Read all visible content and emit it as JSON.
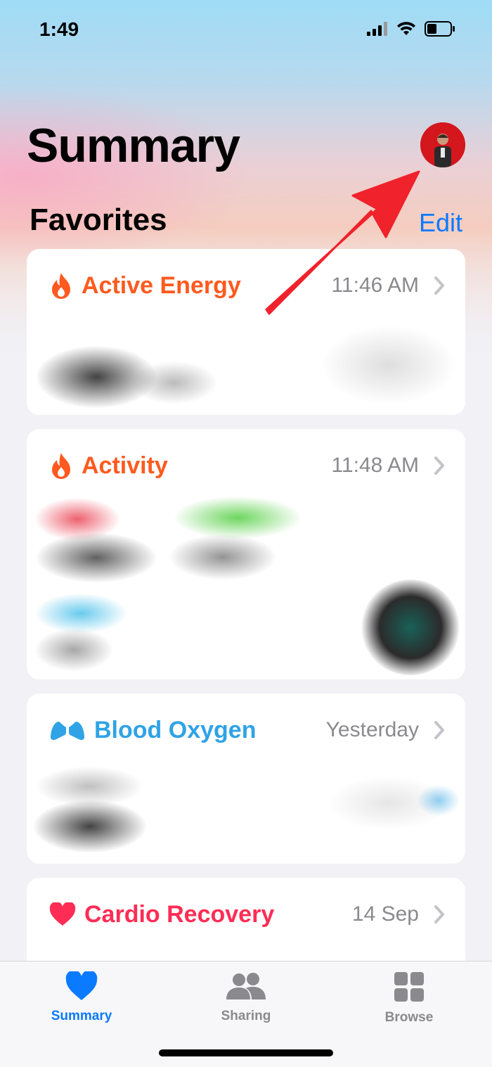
{
  "status_bar": {
    "time": "1:49"
  },
  "header": {
    "title": "Summary"
  },
  "favorites": {
    "title": "Favorites",
    "edit_label": "Edit"
  },
  "cards": [
    {
      "title": "Active Energy",
      "time": "11:46 AM",
      "color": "#ff5a1f",
      "icon": "flame-icon"
    },
    {
      "title": "Activity",
      "time": "11:48 AM",
      "color": "#ff5a1f",
      "icon": "flame-icon"
    },
    {
      "title": "Blood Oxygen",
      "time": "Yesterday",
      "color": "#2fa3e6",
      "icon": "lungs-icon"
    },
    {
      "title": "Cardio Recovery",
      "time": "14 Sep",
      "color": "#ff2d55",
      "icon": "heart-icon"
    }
  ],
  "tabbar": {
    "tabs": [
      {
        "label": "Summary",
        "active": true,
        "icon": "heart-icon"
      },
      {
        "label": "Sharing",
        "active": false,
        "icon": "people-icon"
      },
      {
        "label": "Browse",
        "active": false,
        "icon": "grid-icon"
      }
    ],
    "active_color": "#0a7aff",
    "inactive_color": "#8a8a8e"
  }
}
